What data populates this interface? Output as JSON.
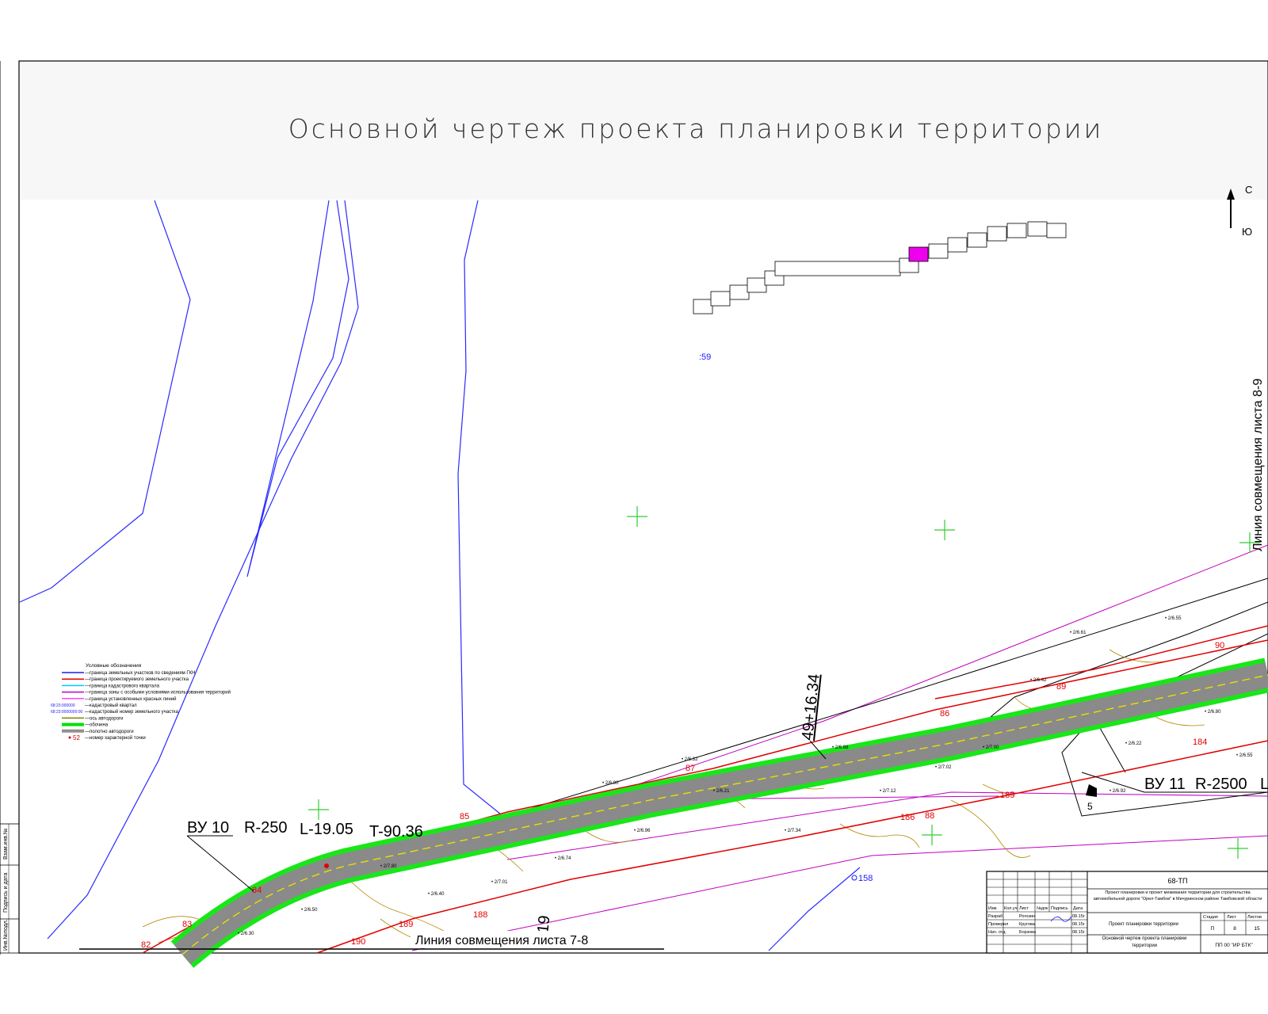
{
  "drawing": {
    "title": "Основной чертеж проекта планировки территории",
    "north": {
      "north_label": "С",
      "south_label": "Ю"
    },
    "match_line_right": "Линия совмещения листа 8-9",
    "match_line_bottom": "Линия совмещения листа 7-8",
    "station_top": "49+16.34",
    "station_bottom": "+19",
    "point_label_blue": ":59",
    "curve_left": {
      "label": "ВУ 10",
      "r": "R-250",
      "l": "L-19.05",
      "t": "T-90.36"
    },
    "curve_right": {
      "label": "ВУ 11",
      "r": "R-2500",
      "l": "L"
    },
    "point_numbers": [
      "87",
      "89",
      "90",
      "86",
      "88",
      "85",
      "84",
      "83",
      "82",
      "184",
      "185",
      "186",
      "188",
      "189",
      "190",
      "158",
      "5"
    ]
  },
  "legend": {
    "title": "Условные обозначения",
    "items": [
      {
        "text": "—граница земельных участков по сведениям ГКН",
        "color": "#1a1aff",
        "style": "line"
      },
      {
        "text": "—граница проектируемого земельного участка",
        "color": "#e00000",
        "style": "line"
      },
      {
        "text": "—граница кадастрового квартала",
        "color": "#00c8ff",
        "style": "line"
      },
      {
        "text": "—граница зоны с особыми условиями использования территорий",
        "color": "#c000c0",
        "style": "line"
      },
      {
        "text": "—граница установленных красных линий",
        "color": "#ff40ff",
        "style": "line"
      },
      {
        "text": "—кадастровый квартал",
        "swatch_text": "68:23:000000",
        "color": "#1a1aff",
        "style": "text"
      },
      {
        "text": "—кадастровый номер земельного участка",
        "swatch_text": "68:23:0000000:00",
        "color": "#1a1aff",
        "style": "text"
      },
      {
        "text": "—ось автодороги",
        "color": "#808000",
        "style": "line"
      },
      {
        "text": "—обочина",
        "color": "#00e000",
        "style": "thick"
      },
      {
        "text": "—полотно автодороги",
        "color": "#909090",
        "style": "thick"
      },
      {
        "text": "—номер характерной точки",
        "swatch_text": "52",
        "color": "#e00000",
        "style": "point"
      }
    ]
  },
  "stamp": {
    "code": "68-ТП",
    "project": "Проект планировки и проект межевания территории для строительства автомобильной дороги \"Орел-Тамбов\" в Мичуринском районе Тамбовской области",
    "section": "Проект планировки территории",
    "sheet_title": "Основной чертеж проекта планировки территории",
    "header_cols": [
      "Изм.",
      "Кол.уч",
      "Лист",
      "№док",
      "Подпись",
      "Дата"
    ],
    "rows": [
      {
        "role": "Разраб.",
        "name": "Рогозин",
        "date": "08.15г"
      },
      {
        "role": "Проверил",
        "name": "Кругова",
        "date": "08.15г"
      },
      {
        "role": "Нач. отд.",
        "name": "Борзова",
        "date": "08.15г"
      }
    ],
    "stage_label": "Стадия",
    "sheet_label": "Лист",
    "sheets_label": "Листов",
    "stage": "П",
    "sheet": "8",
    "sheets": "15",
    "org": "ПП 00 \"ИР БТК\""
  },
  "margin": {
    "labels": [
      "Взам.инв.№",
      "Подпись и дата",
      "Инв.№подл."
    ]
  },
  "colors": {
    "road_surface": "#8a8a8a",
    "road_shoulder": "#19e619",
    "red_line": "#e00000",
    "blue_line": "#1a1aff",
    "magenta_line": "#c000c0",
    "grid_cross": "#33cc33",
    "title_bg": "#f7f7f7"
  }
}
